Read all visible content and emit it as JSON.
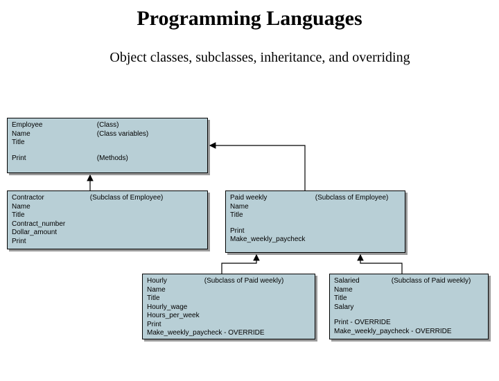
{
  "title": "Programming Languages",
  "subtitle": "Object classes, subclasses, inheritance, and overriding",
  "boxes": {
    "employee": {
      "left_lines": [
        "Employee",
        "Name",
        "Title"
      ],
      "right_lines": [
        "(Class)",
        "(Class variables)"
      ],
      "left2": [
        "Print"
      ],
      "right2": [
        "(Methods)"
      ]
    },
    "contractor": {
      "left_lines": [
        "Contractor",
        "Name",
        "Title",
        "Contract_number",
        "Dollar_amount",
        "Print"
      ],
      "right_lines": [
        "(Subclass of Employee)"
      ]
    },
    "paidweekly": {
      "left_lines": [
        "Paid weekly",
        "Name",
        "Title"
      ],
      "right_lines": [
        "(Subclass of Employee)"
      ],
      "left2": [
        "Print",
        "Make_weekly_paycheck"
      ]
    },
    "hourly": {
      "left_lines": [
        "Hourly",
        "Name",
        "Title",
        "Hourly_wage",
        "Hours_per_week",
        "Print",
        "Make_weekly_paycheck - OVERRIDE"
      ],
      "right_lines": [
        "(Subclass of Paid weekly)"
      ]
    },
    "salaried": {
      "left_lines": [
        "Salaried",
        "Name",
        "Title",
        "Salary"
      ],
      "right_lines": [
        "(Subclass of Paid weekly)"
      ],
      "left2": [
        "Print - OVERRIDE",
        "Make_weekly_paycheck - OVERRIDE"
      ]
    }
  }
}
